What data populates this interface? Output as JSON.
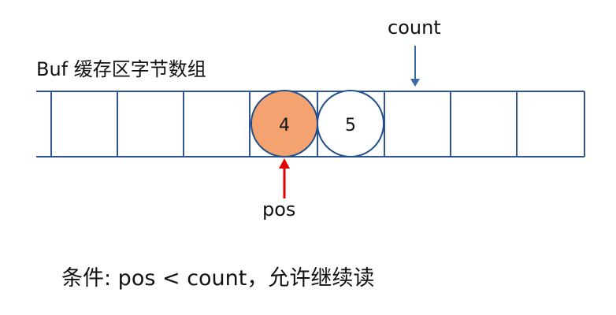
{
  "count_label": "count",
  "buffer_title": "Buf 缓存区字节数组",
  "circles": [
    {
      "label": "4",
      "fill": "#f4a26f",
      "stroke": "#1f4e8c"
    },
    {
      "label": "5",
      "fill": "#ffffff",
      "stroke": "#1f4e8c"
    }
  ],
  "pos_label": "pos",
  "condition_text": "条件:   pos < count，允许继续读",
  "colors": {
    "grid": "#2f5597",
    "count_arrow": "#3b6aa0",
    "pos_arrow": "#e00000"
  }
}
